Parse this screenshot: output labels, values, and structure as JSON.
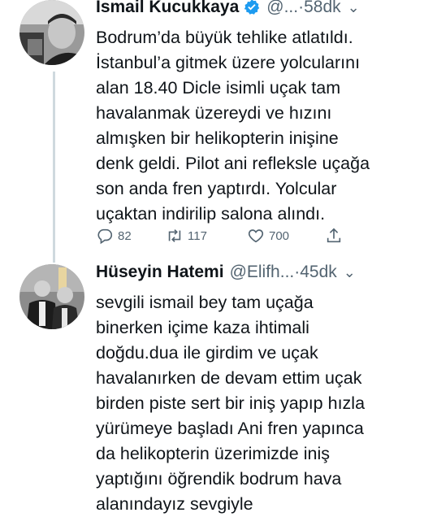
{
  "tweet1": {
    "name": "Ismail Kucukkaya",
    "handle": "@...",
    "time": "·58dk",
    "text_lines": [
      "Bodrum’da büyük tehlike atlatıldı.",
      "İstanbul’a gitmek üzere yolcularını",
      "alan 18.40 Dicle isimli uçak tam",
      "havalanmak üzereydi ve hızını",
      "almışken bir helikopterin inişine",
      "denk geldi. Pilot ani refleksle uçağa",
      "son anda fren yaptırdı. Yolcular",
      "uçaktan indirilip salona alındı."
    ],
    "replies": "82",
    "retweets": "117",
    "likes": "700"
  },
  "tweet2": {
    "name": "Hüseyin Hatemi",
    "handle": "@Elifh...",
    "time": "·45dk",
    "text_lines": [
      "sevgili ismail bey tam uçağa",
      "binerken içime kaza ihtimali",
      "doğdu.dua ile girdim ve uçak",
      "havalanırken de devam ettim uçak",
      "birden piste sert bir iniş yapıp hızla",
      "yürümeye başladı Ani fren yapınca",
      "da helikopterin üzerimizde iniş",
      "yaptığını öğrendik  bodrum hava",
      "alanındayız sevgiyle"
    ]
  },
  "icons": {
    "verified": "verified-badge-icon",
    "chevron": "chevron-down-icon",
    "reply": "reply-icon",
    "retweet": "retweet-icon",
    "like": "heart-icon",
    "share": "share-icon"
  },
  "colors": {
    "verified": "#1d9bf0",
    "secondary_text": "#536471",
    "thread_line": "#cfd9de"
  }
}
